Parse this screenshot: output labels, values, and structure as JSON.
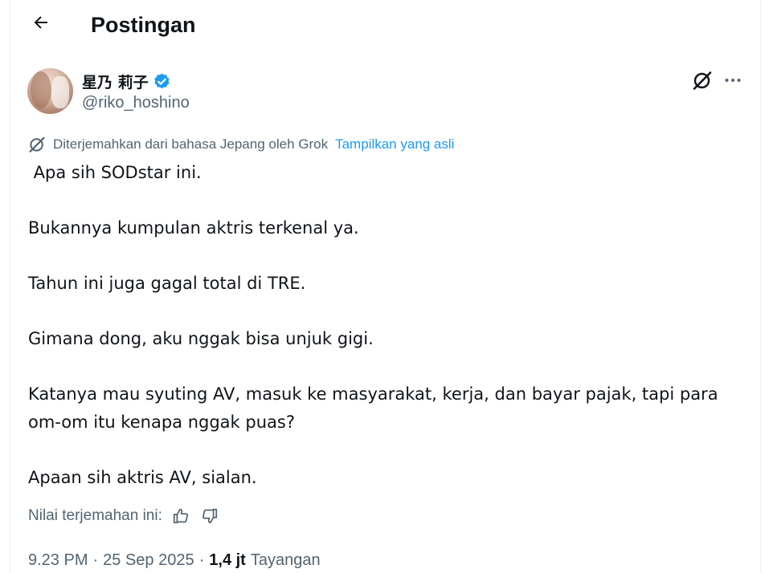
{
  "header": {
    "title": "Postingan",
    "back_icon": "arrow-left-icon"
  },
  "author": {
    "display_name": "星乃 莉子",
    "handle": "@riko_hoshino",
    "verified_icon": "verified-badge-icon",
    "verified_color": "#1d9bf0"
  },
  "actions": {
    "grok_icon": "grok-icon",
    "more_icon": "more-horizontal-icon"
  },
  "translation": {
    "note": "Diterjemahkan dari bahasa Jepang oleh Grok",
    "show_original": "Tampilkan yang asli",
    "link_color": "#1d9bf0"
  },
  "tweet": {
    "paragraphs": [
      " Apa sih SODstar ini.",
      "Bukannya kumpulan aktris terkenal ya.",
      "Tahun ini juga gagal total di TRE.",
      "Gimana dong, aku nggak bisa unjuk gigi.",
      "Katanya mau syuting AV, masuk ke masyarakat, kerja, dan bayar pajak, tapi para om-om itu kenapa nggak puas?",
      "Apaan sih aktris AV, sialan."
    ]
  },
  "rating": {
    "label": "Nilai terjemahan ini:",
    "thumbs_up_icon": "thumbs-up-icon",
    "thumbs_down_icon": "thumbs-down-icon"
  },
  "meta": {
    "time": "9.23 PM",
    "separator": "·",
    "date": "25 Sep 2025",
    "views_count": "1,4 jt",
    "views_label": "Tayangan"
  }
}
